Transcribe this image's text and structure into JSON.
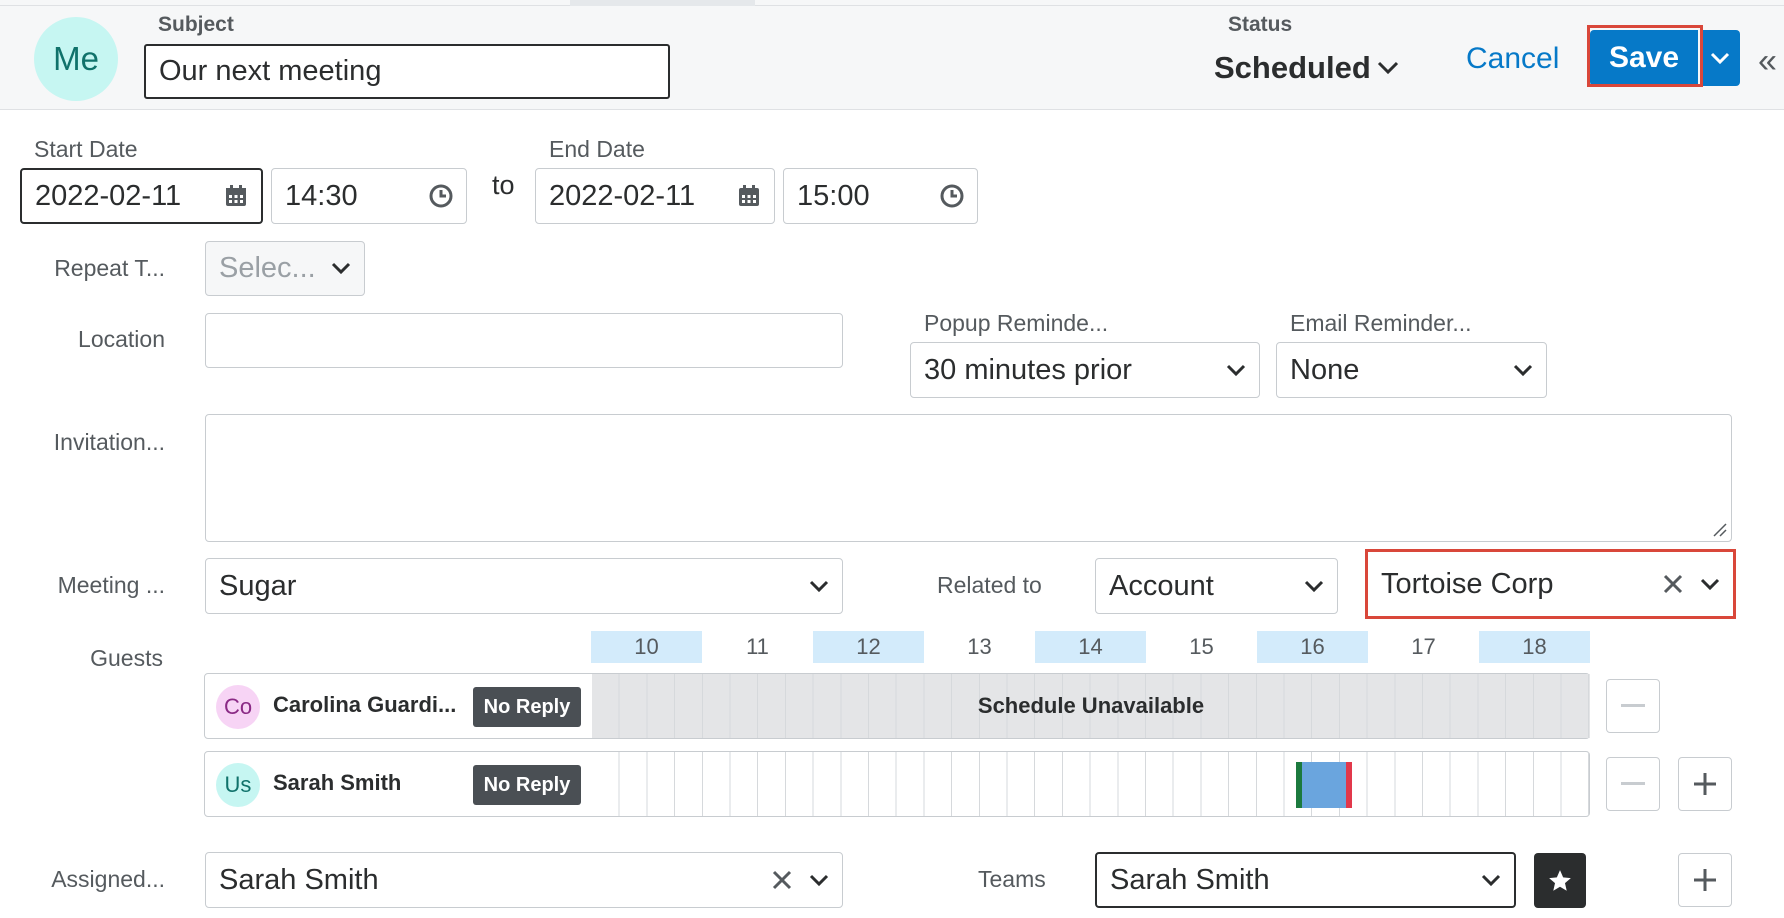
{
  "header": {
    "avatar_initials": "Me",
    "subject_label": "Subject",
    "subject_value": "Our next meeting",
    "status_label": "Status",
    "status_value": "Scheduled",
    "cancel_label": "Cancel",
    "save_label": "Save"
  },
  "dates": {
    "start_label": "Start Date",
    "start_date": "2022-02-11",
    "start_time": "14:30",
    "to_label": "to",
    "end_label": "End Date",
    "end_date": "2022-02-11",
    "end_time": "15:00"
  },
  "repeat": {
    "label": "Repeat T...",
    "placeholder": "Selec..."
  },
  "location": {
    "label": "Location",
    "value": ""
  },
  "popup_reminder": {
    "label": "Popup Reminde...",
    "value": "30 minutes prior"
  },
  "email_reminder": {
    "label": "Email Reminder...",
    "value": "None"
  },
  "invitation": {
    "label": "Invitation..."
  },
  "meeting_type": {
    "label": "Meeting ...",
    "value": "Sugar"
  },
  "related": {
    "label": "Related to",
    "module": "Account",
    "record": "Tortoise Corp"
  },
  "guests": {
    "label": "Guests",
    "hours": [
      "10",
      "11",
      "12",
      "13",
      "14",
      "15",
      "16",
      "17",
      "18"
    ],
    "rows": [
      {
        "initials": "Co",
        "name": "Carolina Guardi...",
        "reply": "No Reply",
        "schedule": "Schedule Unavailable"
      },
      {
        "initials": "Us",
        "name": "Sarah Smith",
        "reply": "No Reply",
        "schedule": ""
      }
    ]
  },
  "assigned": {
    "label": "Assigned...",
    "value": "Sarah Smith"
  },
  "teams": {
    "label": "Teams",
    "value": "Sarah Smith"
  },
  "colors": {
    "accent": "#0679c8",
    "highlight": "#d9473a",
    "hour_highlight": "#d3ebfb",
    "meeting_block": "#6aa5de",
    "meeting_start": "#1c7a3e",
    "meeting_end": "#e2384b"
  },
  "icons": [
    "calendar-icon",
    "clock-icon",
    "chevron-down-icon",
    "close-icon",
    "minus-icon",
    "plus-icon",
    "star-icon",
    "double-chevron-left-icon"
  ]
}
